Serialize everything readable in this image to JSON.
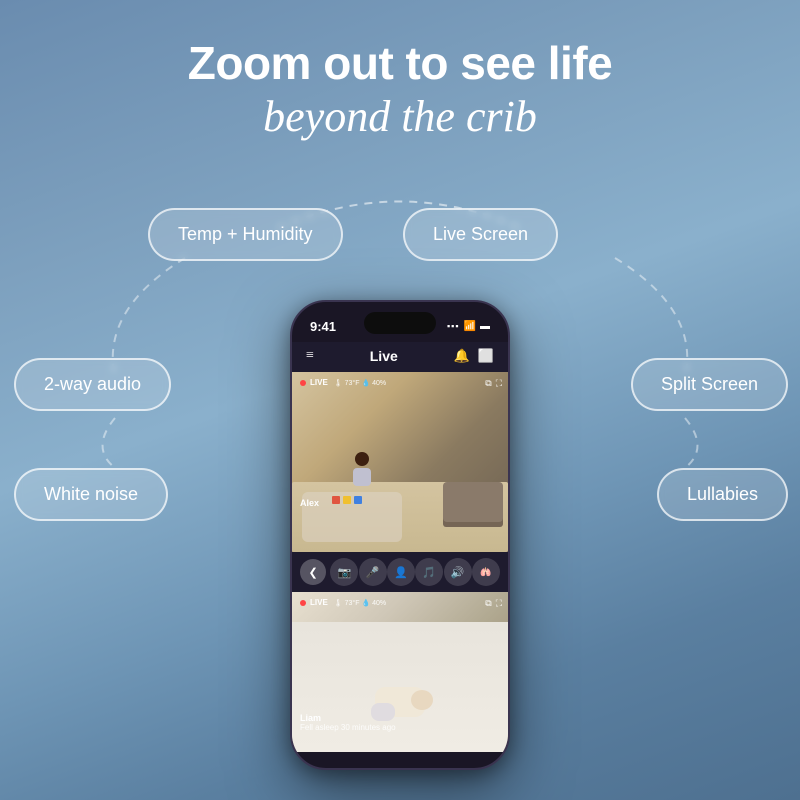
{
  "page": {
    "headline_main": "Zoom out to see life",
    "headline_italic": "beyond the crib",
    "bg_gradient_start": "#6a8caf",
    "bg_gradient_end": "#4e7090"
  },
  "badges": {
    "temp_humidity": "Temp + Humidity",
    "live_screen": "Live Screen",
    "two_way_audio": "2-way audio",
    "split_screen": "Split Screen",
    "white_noise": "White noise",
    "lullabies": "Lullabies"
  },
  "phone": {
    "status_time": "9:41",
    "signal": "▪▪▪",
    "wifi": "WiFi",
    "battery": "🔋",
    "app_title": "Live",
    "camera1": {
      "live_label": "LIVE",
      "temp": "73°F",
      "humidity": "40%",
      "name": "Alex"
    },
    "camera2": {
      "live_label": "LIVE",
      "temp": "73°F",
      "humidity": "40%",
      "name": "Liam",
      "status": "Fell asleep 30 minutes ago"
    }
  },
  "icons": {
    "menu": "≡",
    "bell": "🔔",
    "stop": "⬜",
    "camera": "📷",
    "mic": "🎤",
    "person": "👤",
    "music": "🎵",
    "volume": "🔊",
    "lung": "🫁",
    "expand": "⤢",
    "resize": "⛶",
    "arrow_left": "❮",
    "signal_bars": "📶"
  }
}
